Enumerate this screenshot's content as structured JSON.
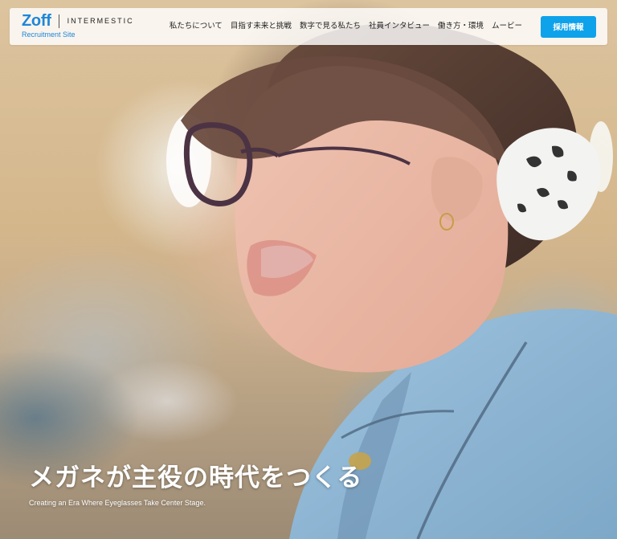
{
  "header": {
    "brand": {
      "primary": "Zoff",
      "secondary": "INTERMESTIC",
      "subtitle": "Recruitment Site"
    },
    "nav": [
      {
        "label": "私たちについて"
      },
      {
        "label": "目指す未来と挑戦"
      },
      {
        "label": "数字で見る私たち"
      },
      {
        "label": "社員インタビュー"
      },
      {
        "label": "働き方・環境"
      },
      {
        "label": "ムービー"
      }
    ],
    "cta_label": "採用情報"
  },
  "hero": {
    "title": "メガネが主役の時代をつくる",
    "subtitle": "Creating an Era Where Eyeglasses Take Center Stage."
  },
  "colors": {
    "brand_blue": "#1f86d8",
    "cta_blue": "#0ea2ea"
  }
}
